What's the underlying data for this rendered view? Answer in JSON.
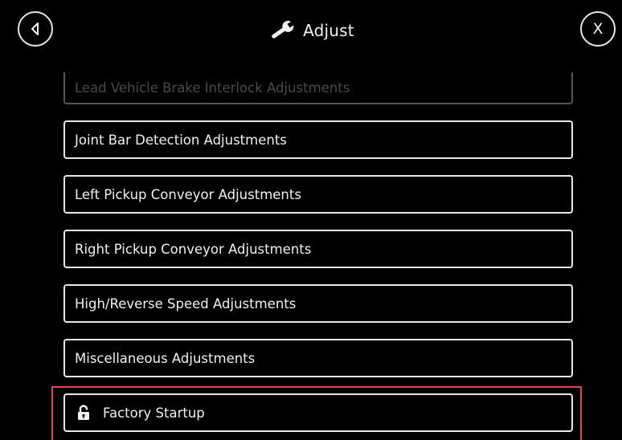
{
  "header": {
    "title": "Adjust",
    "title_icon": "wrench-icon",
    "back_icon": "back-arrow-icon",
    "close_label": "X"
  },
  "menu": {
    "items": [
      {
        "label": "Lead Vehicle Brake Interlock Adjustments",
        "state": "scrolled-partially-out"
      },
      {
        "label": "Joint Bar Detection Adjustments"
      },
      {
        "label": "Left Pickup Conveyor Adjustments"
      },
      {
        "label": "Right Pickup Conveyor Adjustments"
      },
      {
        "label": "High/Reverse Speed Adjustments"
      },
      {
        "label": "Miscellaneous Adjustments"
      },
      {
        "label": "Factory Startup",
        "icon": "unlocked-padlock-icon"
      }
    ]
  },
  "annotation": {
    "highlight_color": "#e04848"
  },
  "colors": {
    "background": "#000000",
    "foreground": "#f2f2f2",
    "faded_text": "#4a4a4a"
  }
}
